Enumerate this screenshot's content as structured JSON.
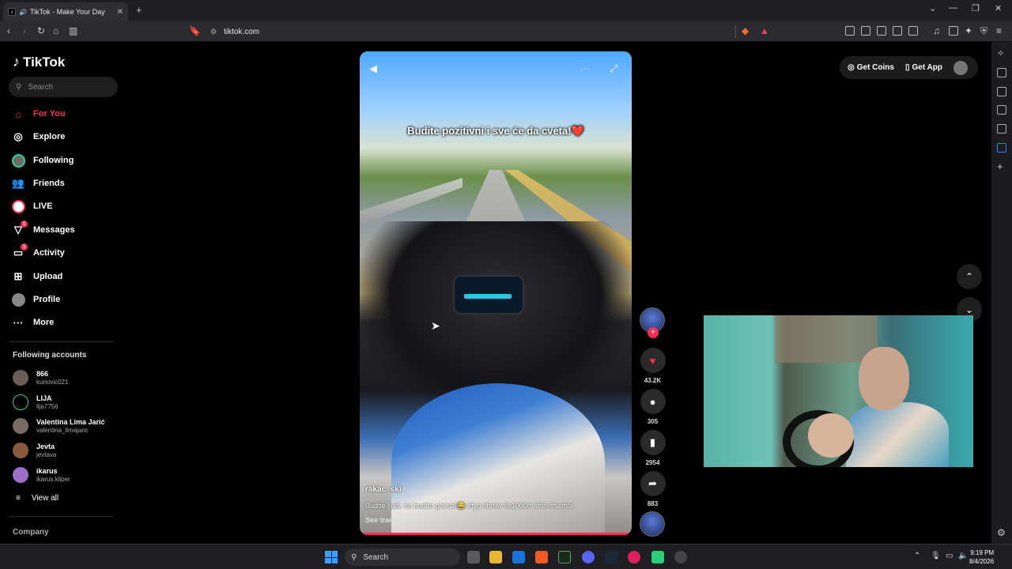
{
  "browser": {
    "tab_title": "TikTok - Make Your Day",
    "new_tab": "+",
    "url": "tiktok.com"
  },
  "tiktok": {
    "brand": "TikTok",
    "search_placeholder": "Search",
    "nav": [
      {
        "label": "For You",
        "icon": "home-icon"
      },
      {
        "label": "Explore",
        "icon": "compass-icon"
      },
      {
        "label": "Following",
        "icon": "following-avatar-icon"
      },
      {
        "label": "Friends",
        "icon": "friends-icon"
      },
      {
        "label": "LIVE",
        "icon": "live-icon"
      },
      {
        "label": "Messages",
        "icon": "messages-icon",
        "badge": "1"
      },
      {
        "label": "Activity",
        "icon": "activity-icon",
        "badge": "1"
      },
      {
        "label": "Upload",
        "icon": "upload-icon"
      },
      {
        "label": "Profile",
        "icon": "profile-avatar-icon"
      },
      {
        "label": "More",
        "icon": "more-icon"
      }
    ],
    "following_header": "Following accounts",
    "accounts": [
      {
        "name": "866",
        "handle": "kunovic021"
      },
      {
        "name": "LIJA",
        "handle": "lija7756"
      },
      {
        "name": "Valentina Lima Jarić",
        "handle": "valentina_limajaric"
      },
      {
        "name": "Jevta",
        "handle": "jevtava"
      },
      {
        "name": "ikarus",
        "handle": "ikarus.kliper"
      }
    ],
    "view_all": "View all",
    "company": "Company",
    "top_actions": {
      "coins": "Get Coins",
      "app": "Get App"
    }
  },
  "video": {
    "overlay_caption": "Budite pozitivni i sve će da cveta!❤️",
    "author": "rakac_ski",
    "description": "Budite ljudi, ne budite govna!😂 #fyp #bmw #s1000rr #fun #serbia",
    "see_translation": "See translation",
    "likes": "43.2K",
    "comments": "305",
    "saves": "2954",
    "shares": "883"
  },
  "taskbar": {
    "search": "Search",
    "time": "9:19 PM",
    "date": "8/4/2026"
  },
  "colors": {
    "accent": "#fe2c55",
    "background": "#000000"
  }
}
